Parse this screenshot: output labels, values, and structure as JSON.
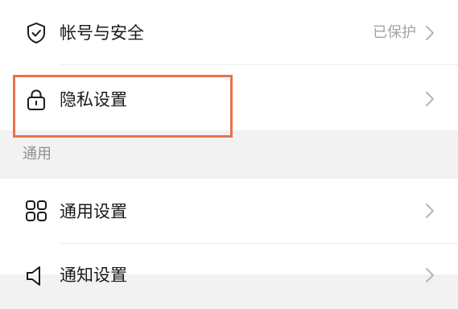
{
  "settings": {
    "account_security": {
      "label": "帐号与安全",
      "value": "已保护",
      "icon": "shield-check-icon"
    },
    "privacy": {
      "label": "隐私设置",
      "icon": "lock-icon"
    },
    "section_general": "通用",
    "general": {
      "label": "通用设置",
      "icon": "grid-icon"
    },
    "notifications": {
      "label": "通知设置",
      "icon": "speaker-icon"
    }
  },
  "colors": {
    "highlight": "#e6734b",
    "background": "#f2f2f2",
    "card": "#ffffff",
    "text": "#1a1a1a",
    "secondary_text": "#a3a3a3"
  }
}
